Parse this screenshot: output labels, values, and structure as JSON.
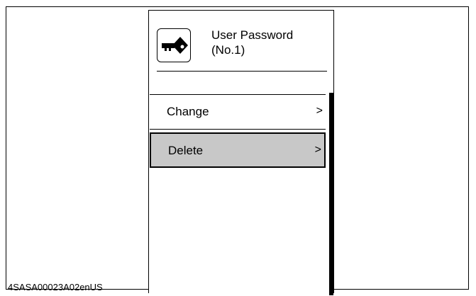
{
  "document_id": "4SASA00023A02enUS",
  "header": {
    "icon": "key-icon",
    "title_line1": "User Password",
    "title_line2": "(No.1)"
  },
  "menu": {
    "items": [
      {
        "label": "Change",
        "chevron": ">"
      },
      {
        "label": "Delete",
        "chevron": ">"
      }
    ],
    "selected_index": 1
  },
  "colors": {
    "selected_background": "#c8c8c8",
    "foreground": "#000000"
  }
}
